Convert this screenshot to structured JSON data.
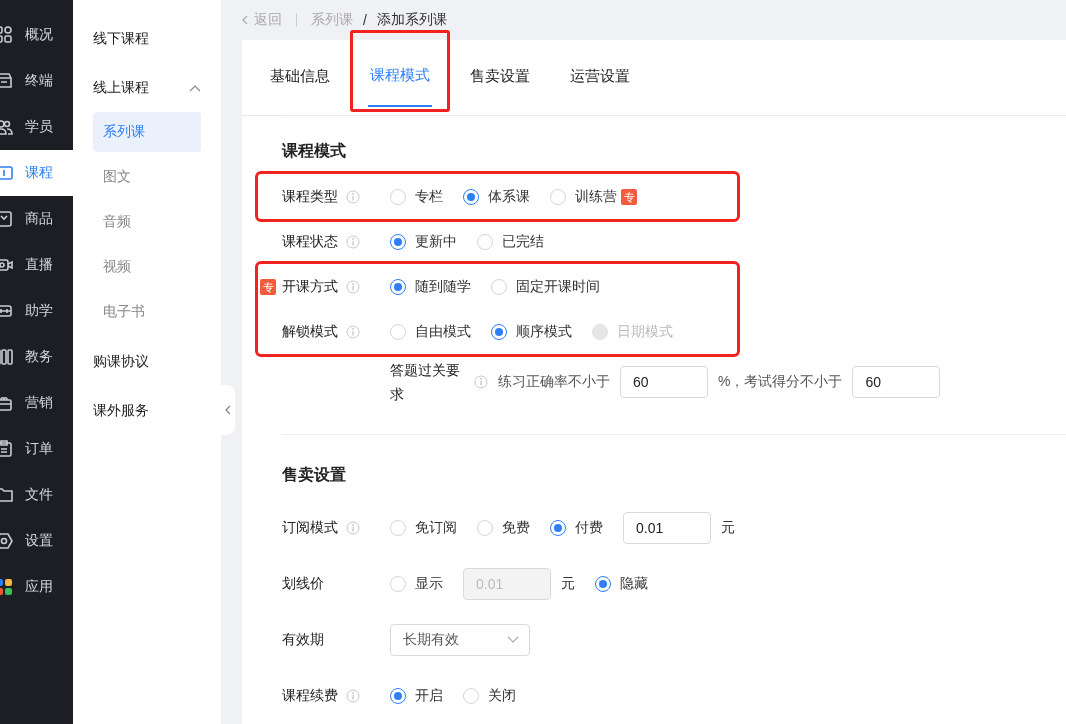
{
  "main_nav": [
    {
      "label": "概况",
      "selected": false
    },
    {
      "label": "终端",
      "selected": false
    },
    {
      "label": "学员",
      "selected": false
    },
    {
      "label": "课程",
      "selected": true
    },
    {
      "label": "商品",
      "selected": false
    },
    {
      "label": "直播",
      "selected": false
    },
    {
      "label": "助学",
      "selected": false
    },
    {
      "label": "教务",
      "selected": false
    },
    {
      "label": "营销",
      "selected": false
    },
    {
      "label": "订单",
      "selected": false
    },
    {
      "label": "文件",
      "selected": false
    },
    {
      "label": "设置",
      "selected": false
    },
    {
      "label": "应用",
      "selected": false
    }
  ],
  "sub_nav": [
    {
      "label": "线下课程",
      "expanded": false
    },
    {
      "label": "线上课程",
      "expanded": true,
      "children": [
        {
          "label": "系列课",
          "selected": true
        },
        {
          "label": "图文",
          "selected": false
        },
        {
          "label": "音频",
          "selected": false
        },
        {
          "label": "视频",
          "selected": false
        },
        {
          "label": "电子书",
          "selected": false
        }
      ]
    },
    {
      "label": "购课协议",
      "expanded": false
    },
    {
      "label": "课外服务",
      "expanded": false
    }
  ],
  "breadcrumb": {
    "back": "返回",
    "items": [
      "系列课",
      "添加系列课"
    ],
    "separator": "/"
  },
  "tabs": [
    {
      "label": "基础信息",
      "selected": false,
      "highlighted": false
    },
    {
      "label": "课程模式",
      "selected": true,
      "highlighted": true
    },
    {
      "label": "售卖设置",
      "selected": false,
      "highlighted": false
    },
    {
      "label": "运营设置",
      "selected": false,
      "highlighted": false
    }
  ],
  "sections": [
    {
      "title": "课程模式",
      "groups": [
        {
          "highlighted": true,
          "rows": [
            {
              "label": "课程类型",
              "info": true,
              "items": [
                {
                  "kind": "radio",
                  "label": "专栏",
                  "selected": false,
                  "disabled": false
                },
                {
                  "kind": "radio",
                  "label": "体系课",
                  "selected": true,
                  "disabled": false
                },
                {
                  "kind": "radio",
                  "label": "训练营",
                  "selected": false,
                  "disabled": false,
                  "badge": "专"
                }
              ]
            }
          ]
        },
        {
          "highlighted": false,
          "rows": [
            {
              "label": "课程状态",
              "info": true,
              "items": [
                {
                  "kind": "radio",
                  "label": "更新中",
                  "selected": true,
                  "disabled": false
                },
                {
                  "kind": "radio",
                  "label": "已完结",
                  "selected": false,
                  "disabled": false
                }
              ]
            }
          ]
        },
        {
          "highlighted": true,
          "rows": [
            {
              "label": "开课方式",
              "badge": "专",
              "info": true,
              "items": [
                {
                  "kind": "radio",
                  "label": "随到随学",
                  "selected": true,
                  "disabled": false
                },
                {
                  "kind": "radio",
                  "label": "固定开课时间",
                  "selected": false,
                  "disabled": false
                }
              ]
            },
            {
              "label": "解锁模式",
              "info": true,
              "items": [
                {
                  "kind": "radio",
                  "label": "自由模式",
                  "selected": false,
                  "disabled": false
                },
                {
                  "kind": "radio",
                  "label": "顺序模式",
                  "selected": true,
                  "disabled": false
                },
                {
                  "kind": "radio",
                  "label": "日期模式",
                  "selected": false,
                  "disabled": true
                }
              ]
            }
          ]
        },
        {
          "highlighted": false,
          "rows": [
            {
              "label": "答题过关要求",
              "info": true,
              "nested": true,
              "items": [
                {
                  "kind": "text",
                  "label": "练习正确率不小于"
                },
                {
                  "kind": "input",
                  "value": "60",
                  "disabled": false
                },
                {
                  "kind": "text",
                  "label": "%，考试得分不小于"
                },
                {
                  "kind": "input",
                  "value": "60",
                  "disabled": false
                }
              ]
            }
          ]
        }
      ]
    },
    {
      "title": "售卖设置",
      "groups": [
        {
          "highlighted": false,
          "rows": [
            {
              "label": "订阅模式",
              "info": true,
              "items": [
                {
                  "kind": "radio",
                  "label": "免订阅",
                  "selected": false,
                  "disabled": false
                },
                {
                  "kind": "radio",
                  "label": "免费",
                  "selected": false,
                  "disabled": false
                },
                {
                  "kind": "radio",
                  "label": "付费",
                  "selected": true,
                  "disabled": false
                },
                {
                  "kind": "input",
                  "value": "0.01",
                  "disabled": false
                },
                {
                  "kind": "unit",
                  "label": "元"
                }
              ]
            },
            {
              "label": "划线价",
              "info": false,
              "items": [
                {
                  "kind": "radio",
                  "label": "显示",
                  "selected": false,
                  "disabled": false
                },
                {
                  "kind": "input",
                  "value": "0.01",
                  "disabled": true
                },
                {
                  "kind": "unit",
                  "label": "元"
                },
                {
                  "kind": "radio",
                  "label": "隐藏",
                  "selected": true,
                  "disabled": false
                }
              ]
            },
            {
              "label": "有效期",
              "info": false,
              "items": [
                {
                  "kind": "select",
                  "value": "长期有效"
                }
              ]
            },
            {
              "label": "课程续费",
              "info": true,
              "items": [
                {
                  "kind": "radio",
                  "label": "开启",
                  "selected": true,
                  "disabled": false
                },
                {
                  "kind": "radio",
                  "label": "关闭",
                  "selected": false,
                  "disabled": false
                }
              ]
            }
          ]
        }
      ]
    }
  ]
}
